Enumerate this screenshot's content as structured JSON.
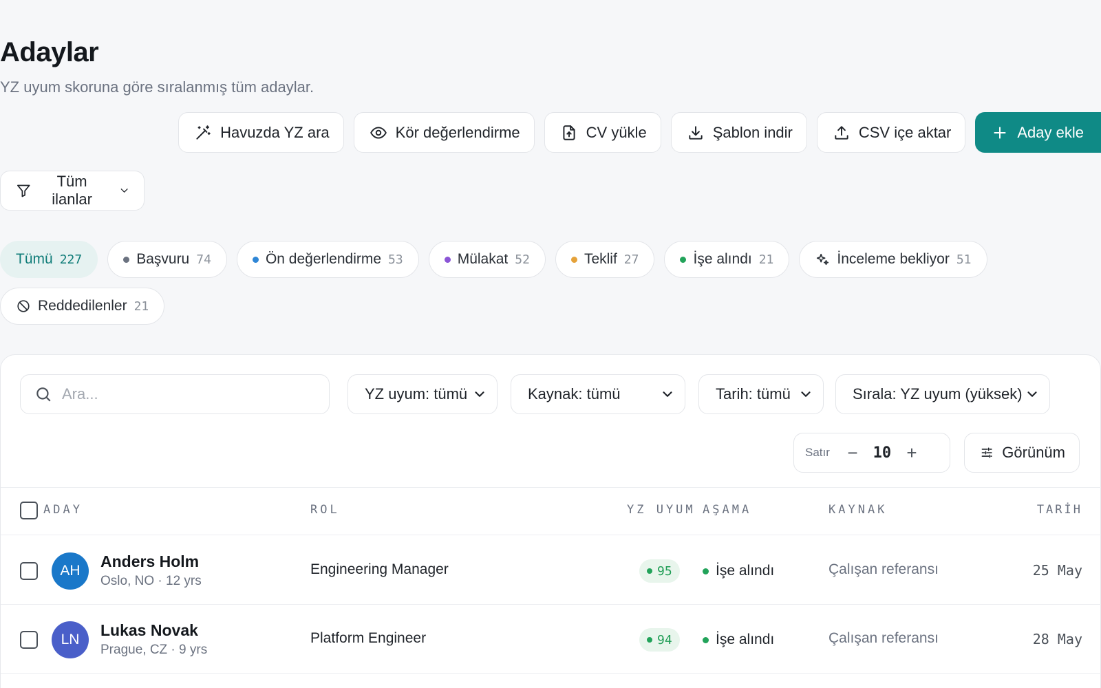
{
  "header": {
    "title": "Adaylar",
    "subtitle": "YZ uyum skoruna göre sıralanmış tüm adaylar."
  },
  "actions": {
    "ai_search": "Havuzda YZ ara",
    "blind_review": "Kör değerlendirme",
    "upload_cv": "CV yükle",
    "download_template": "Şablon indir",
    "import_csv": "CSV içe aktar",
    "add_candidate": "Aday ekle"
  },
  "job_filter": {
    "label": "Tüm ilanlar"
  },
  "status_tabs": [
    {
      "label": "Tümü",
      "count": "227",
      "active": true
    },
    {
      "label": "Başvuru",
      "count": "74",
      "dot": "#6b7280"
    },
    {
      "label": "Ön değerlendirme",
      "count": "53",
      "dot": "#2f86d6"
    },
    {
      "label": "Mülakat",
      "count": "52",
      "dot": "#8b55d6"
    },
    {
      "label": "Teklif",
      "count": "27",
      "dot": "#e5a23a"
    },
    {
      "label": "İşe alındı",
      "count": "21",
      "dot": "#22a35a"
    },
    {
      "label": "İnceleme bekliyor",
      "count": "51",
      "icon": "sparkles-icon"
    },
    {
      "label": "Reddedilenler",
      "count": "21",
      "icon": "ban-icon"
    }
  ],
  "filters": {
    "search_placeholder": "Ara...",
    "ai_fit": "YZ uyum: tümü",
    "source": "Kaynak: tümü",
    "date": "Tarih: tümü",
    "sort": "Sırala: YZ uyum (yüksek)"
  },
  "rows_control": {
    "label": "Satır",
    "value": "10"
  },
  "view_button": "Görünüm",
  "table": {
    "columns": {
      "candidate": "ADAY",
      "role": "ROL",
      "ai_fit": "YZ UYUM",
      "stage": "AŞAMA",
      "source": "KAYNAK",
      "date": "TARİH"
    },
    "rows": [
      {
        "initials": "AH",
        "name": "Anders Holm",
        "meta": "Oslo, NO · 12 yrs",
        "role": "Engineering Manager",
        "score": "95",
        "stage": "İşe alındı",
        "source": "Çalışan referansı",
        "date": "25 May"
      },
      {
        "initials": "LN",
        "name": "Lukas Novak",
        "meta": "Prague, CZ · 9 yrs",
        "role": "Platform Engineer",
        "score": "94",
        "stage": "İşe alındı",
        "source": "Çalışan referansı",
        "date": "28 May"
      }
    ]
  },
  "colors": {
    "primary": "#0f8a86",
    "avatar_ah": "#1a78c9",
    "avatar_ln": "#4a5fc9",
    "success": "#22a35a"
  }
}
